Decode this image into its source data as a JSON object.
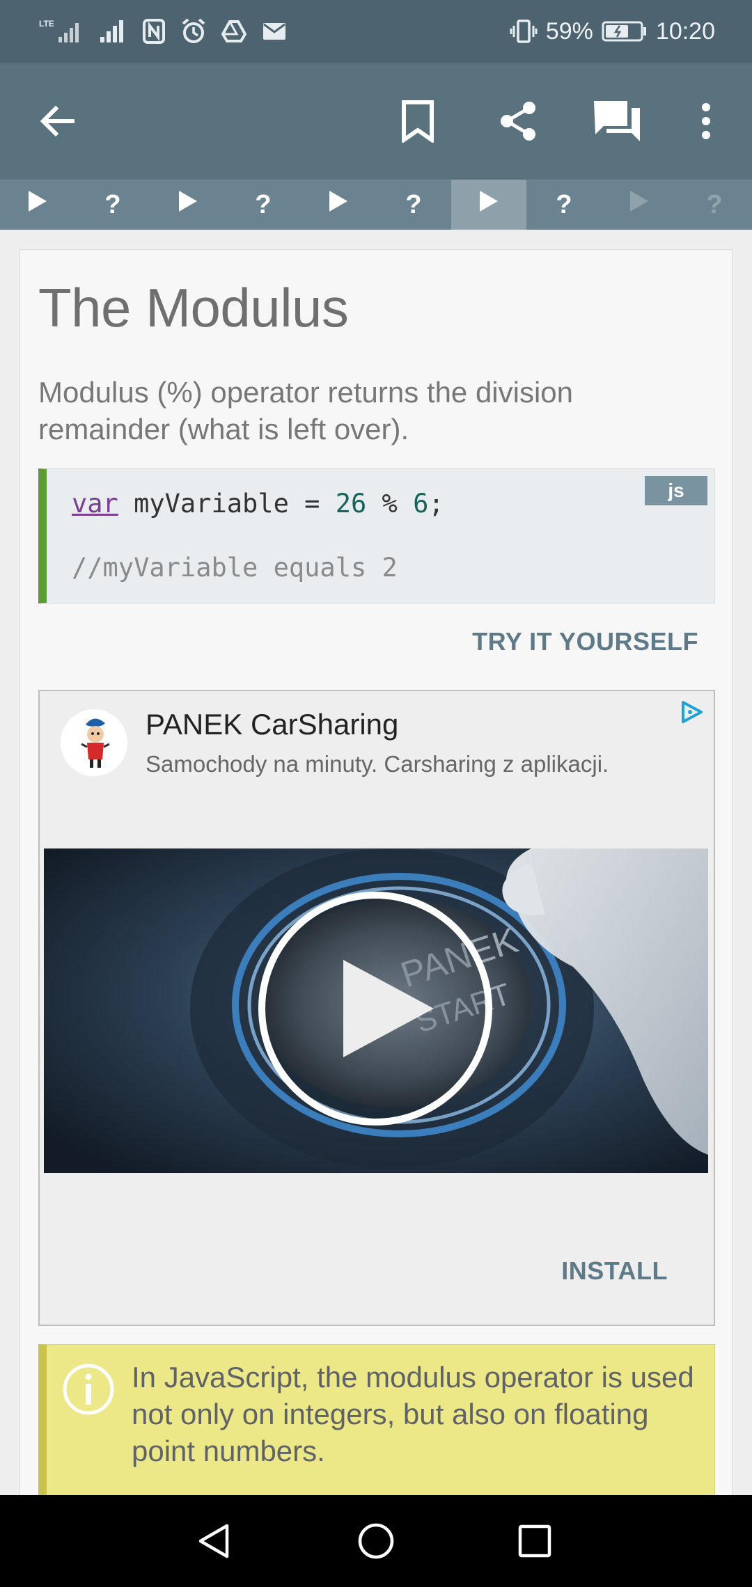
{
  "status_bar": {
    "network": "LTE",
    "battery": "59%",
    "time": "10:20"
  },
  "app_bar": {
    "back_icon": "arrow-back-icon",
    "actions": [
      "bookmark-icon",
      "share-icon",
      "comments-icon",
      "more-vert-icon"
    ]
  },
  "progress_tabs": [
    {
      "icon": "play",
      "label": "▶",
      "state": "done"
    },
    {
      "icon": "quiz",
      "label": "?",
      "state": "done"
    },
    {
      "icon": "play",
      "label": "▶",
      "state": "done"
    },
    {
      "icon": "quiz",
      "label": "?",
      "state": "done"
    },
    {
      "icon": "play",
      "label": "▶",
      "state": "done"
    },
    {
      "icon": "quiz",
      "label": "?",
      "state": "done"
    },
    {
      "icon": "play",
      "label": "▶",
      "state": "active"
    },
    {
      "icon": "quiz",
      "label": "?",
      "state": "done"
    },
    {
      "icon": "play",
      "label": "▶",
      "state": "locked"
    },
    {
      "icon": "quiz",
      "label": "?",
      "state": "locked"
    }
  ],
  "lesson": {
    "title": "The Modulus",
    "intro": "Modulus (%) operator returns the division remainder (what is left over).",
    "code": {
      "language": "js",
      "keyword": "var",
      "line1_rest_a": " myVariable = ",
      "num1": "26",
      "op": " % ",
      "num2": "6",
      "semi": ";",
      "comment": "//myVariable equals 2"
    },
    "try_label": "TRY IT YOURSELF"
  },
  "ad": {
    "title": "PANEK CarSharing",
    "description": "Samochody na minuty. Carsharing z aplikacji.",
    "video_overlay_text": [
      "PANEK",
      "START"
    ],
    "install_label": "INSTALL"
  },
  "note": {
    "text": "In JavaScript, the modulus operator is used not only on integers, but also on floating point numbers."
  },
  "colors": {
    "status_bar": "#4d6470",
    "app_bar": "#59727e",
    "tabs_bar": "#6b8390",
    "tab_active": "#8ea1aa",
    "code_border": "#5d9b37",
    "note_bg": "#ece887",
    "link": "#5e7a88"
  }
}
